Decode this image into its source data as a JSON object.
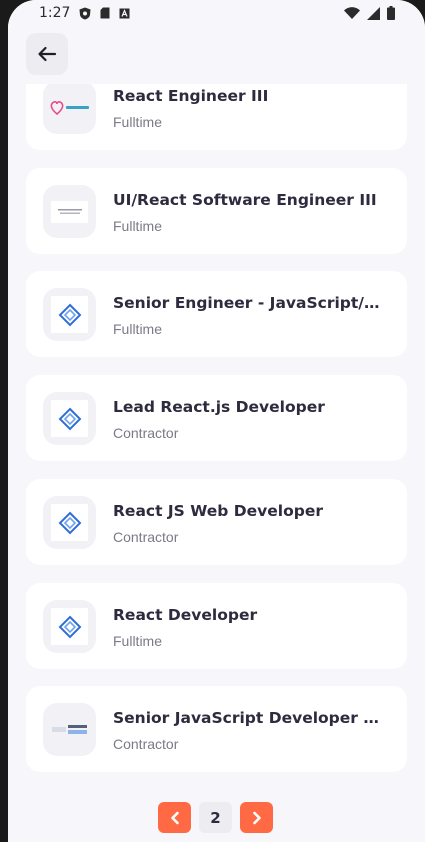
{
  "status_bar": {
    "time": "1:27",
    "icons": [
      "shield-notification-icon",
      "sim-card-icon",
      "font-a-icon",
      "wifi-icon",
      "signal-icon",
      "battery-icon"
    ]
  },
  "header": {
    "back_icon": "arrow-left-icon"
  },
  "jobs": [
    {
      "title": "React Engineer III",
      "type": "Fulltime",
      "logo": "heart-logo"
    },
    {
      "title": "UI/React Software Engineer III",
      "type": "Fulltime",
      "logo": "text-logo"
    },
    {
      "title": "Senior Engineer - JavaScript/R...",
      "type": "Fulltime",
      "logo": "diamond-logo"
    },
    {
      "title": "Lead React.js Developer",
      "type": "Contractor",
      "logo": "diamond-logo"
    },
    {
      "title": "React JS Web Developer",
      "type": "Contractor",
      "logo": "diamond-logo"
    },
    {
      "title": "React Developer",
      "type": "Fulltime",
      "logo": "diamond-logo"
    },
    {
      "title": "Senior JavaScript Developer -...",
      "type": "Contractor",
      "logo": "banner-logo"
    }
  ],
  "pagination": {
    "current_page": "2",
    "prev_icon": "chevron-left-icon",
    "next_icon": "chevron-right-icon"
  },
  "colors": {
    "accent": "#ff6a45",
    "background": "#f7f7fb",
    "card": "#ffffff",
    "title": "#2d2b3d",
    "subtitle": "#7b7b87"
  }
}
